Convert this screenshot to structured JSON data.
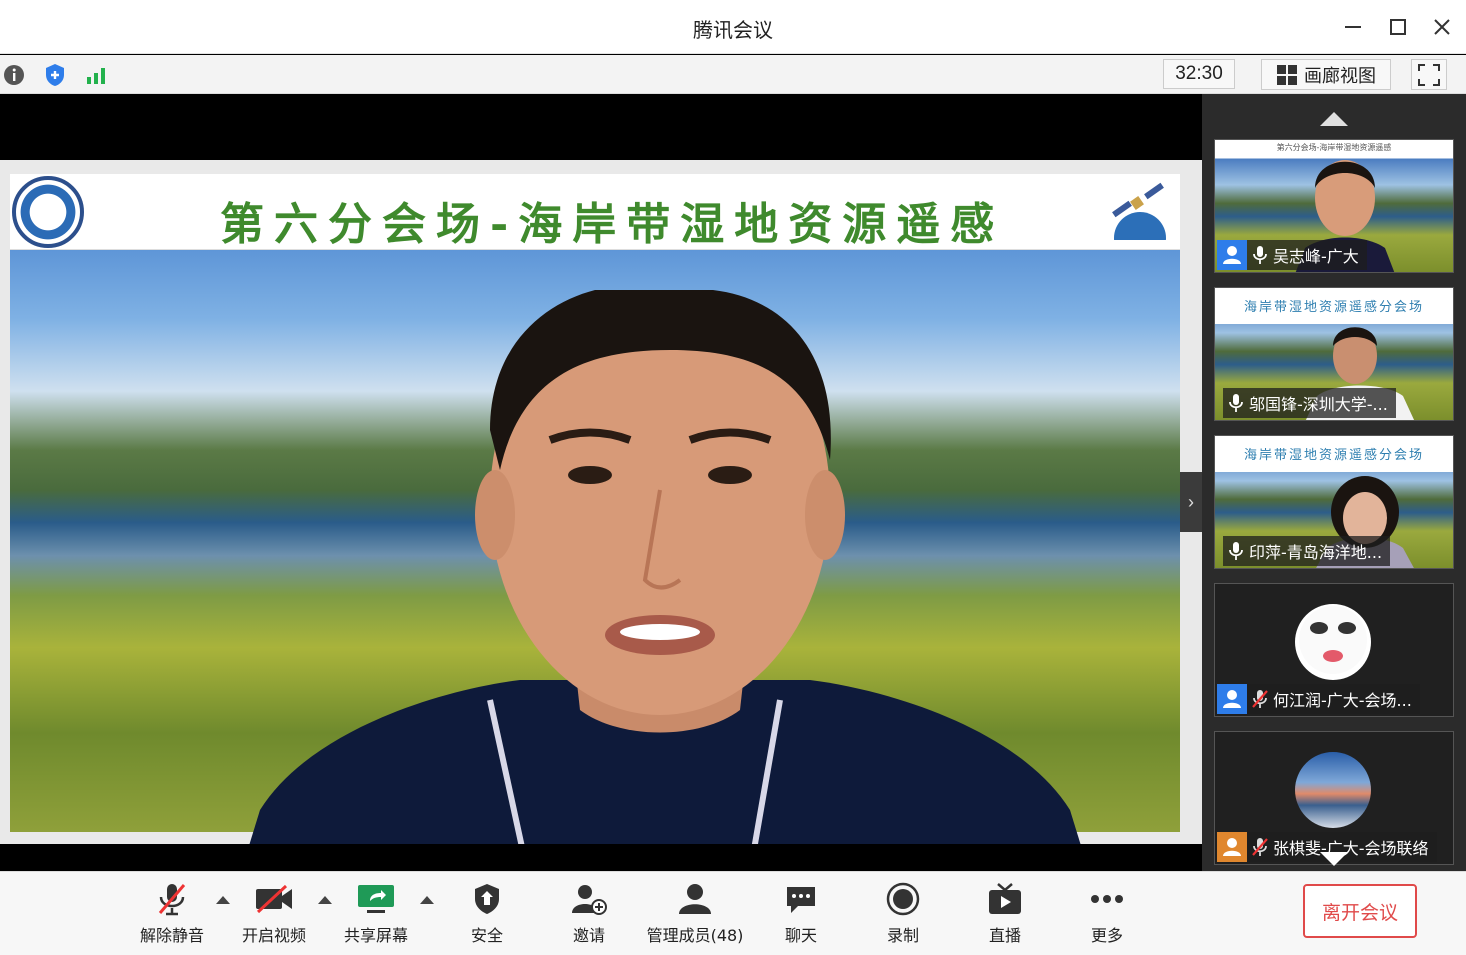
{
  "window": {
    "title": "腾讯会议"
  },
  "infobar": {
    "timer": "32:30",
    "gallery_label": "画廊视图"
  },
  "main_video": {
    "slide_title": "第六分会场-海岸带湿地资源遥感"
  },
  "participants": [
    {
      "name": "吴志峰-广大",
      "mic": "on",
      "badge": "blue"
    },
    {
      "name": "邬国锋-深圳大学-...",
      "mic": "on",
      "badge": "none",
      "slide_title": "海岸带湿地资源遥感分会场"
    },
    {
      "name": "印萍-青岛海洋地...",
      "mic": "on",
      "badge": "none",
      "slide_title": "海岸带湿地资源遥感分会场"
    },
    {
      "name": "何江润-广大-会场...",
      "mic": "muted",
      "badge": "blue"
    },
    {
      "name": "张棋斐-广大-会场联络",
      "mic": "muted",
      "badge": "orange"
    }
  ],
  "toolbar": {
    "unmute": "解除静音",
    "start_video": "开启视频",
    "share_screen": "共享屏幕",
    "security": "安全",
    "invite": "邀请",
    "manage_members": "管理成员(48)",
    "chat": "聊天",
    "record": "录制",
    "live": "直播",
    "more": "更多",
    "leave": "离开会议"
  }
}
